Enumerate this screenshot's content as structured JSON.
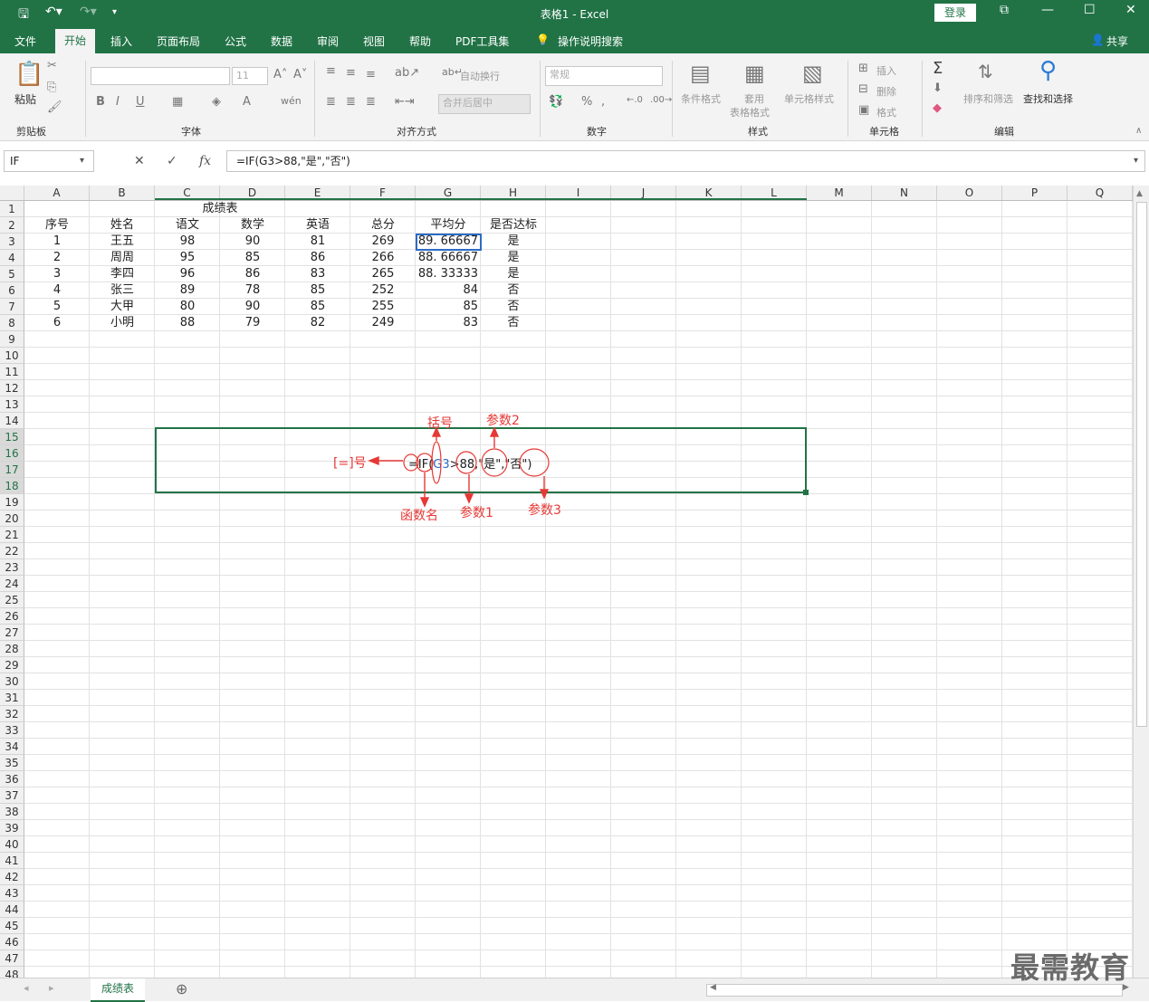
{
  "app": {
    "window_title": "表格1  -  Excel",
    "login": "登录",
    "share": "共享"
  },
  "ribbon_tabs": [
    "文件",
    "开始",
    "插入",
    "页面布局",
    "公式",
    "数据",
    "审阅",
    "视图",
    "帮助",
    "PDF工具集",
    "操作说明搜索"
  ],
  "ribbon": {
    "clipboard": {
      "paste": "粘贴",
      "group": "剪贴板"
    },
    "font": {
      "size": "11",
      "group": "字体"
    },
    "align": {
      "wrap": "自动换行",
      "merge": "合并后居中",
      "group": "对齐方式"
    },
    "number": {
      "format": "常规",
      "group": "数字"
    },
    "styles": {
      "cond": "条件格式",
      "table1": "套用",
      "table2": "表格格式",
      "cellstyle": "单元格样式",
      "group": "样式"
    },
    "cells": {
      "insert": "插入",
      "delete": "删除",
      "format": "格式",
      "group": "单元格"
    },
    "edit": {
      "sort": "排序和筛选",
      "find": "查找和选择",
      "group": "编辑"
    }
  },
  "formula_bar": {
    "name_box": "IF",
    "formula": "=IF(G3>88,\"是\",\"否\")"
  },
  "columns": [
    "A",
    "B",
    "C",
    "D",
    "E",
    "F",
    "G",
    "H",
    "I",
    "J",
    "K",
    "L",
    "M",
    "N",
    "O",
    "P",
    "Q"
  ],
  "rows": [
    "1",
    "2",
    "3",
    "4",
    "5",
    "6",
    "7",
    "8",
    "9",
    "10",
    "11",
    "12",
    "13",
    "14",
    "15",
    "16",
    "17",
    "18",
    "19",
    "20",
    "21",
    "22",
    "23",
    "24",
    "25",
    "26",
    "27",
    "28",
    "29",
    "30",
    "31",
    "32",
    "33",
    "34",
    "35",
    "36",
    "37",
    "38",
    "39",
    "40",
    "41",
    "42",
    "43",
    "44",
    "45",
    "46",
    "47",
    "48"
  ],
  "table": {
    "title": "成绩表",
    "headers": [
      "序号",
      "姓名",
      "语文",
      "数学",
      "英语",
      "总分",
      "平均分",
      "是否达标"
    ],
    "rows": [
      [
        "1",
        "王五",
        "98",
        "90",
        "81",
        "269",
        "89. 66667",
        "是"
      ],
      [
        "2",
        "周周",
        "95",
        "85",
        "86",
        "266",
        "88. 66667",
        "是"
      ],
      [
        "3",
        "李四",
        "96",
        "86",
        "83",
        "265",
        "88. 33333",
        "是"
      ],
      [
        "4",
        "张三",
        "89",
        "78",
        "85",
        "252",
        "84",
        "否"
      ],
      [
        "5",
        "大甲",
        "80",
        "90",
        "85",
        "255",
        "85",
        "否"
      ],
      [
        "6",
        "小明",
        "88",
        "79",
        "82",
        "249",
        "83",
        "否"
      ]
    ]
  },
  "annotation": {
    "formula_eq": "=",
    "formula_if": "IF",
    "formula_open": "(",
    "formula_ref": "G3",
    "formula_gt": ">",
    "formula_num": "88",
    "formula_sep1": ",",
    "formula_yes": "\"是\"",
    "formula_sep2": ",",
    "formula_no": "\"否\"",
    "formula_close": ")",
    "equals_label": "[=]号",
    "paren_label": "括号",
    "param2_label": "参数2",
    "func_label": "函数名",
    "param1_label": "参数1",
    "param3_label": "参数3"
  },
  "sheet_tab": "成绩表",
  "watermark": "最需教育"
}
